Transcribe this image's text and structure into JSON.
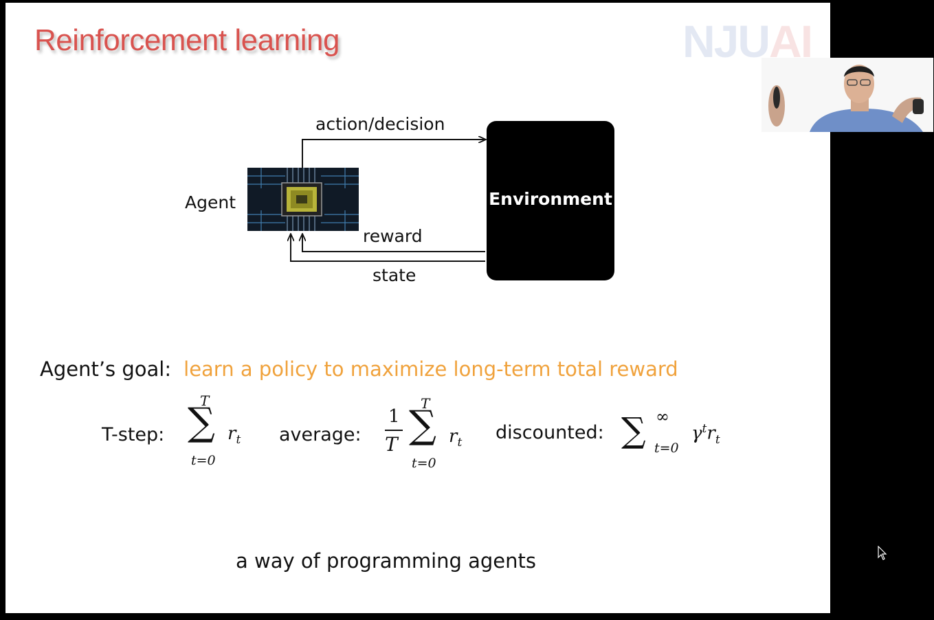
{
  "slide": {
    "title": "Reinforcement learning",
    "logo": {
      "part1": "NJU",
      "part2": "AI"
    },
    "diagram": {
      "agent_label": "Agent",
      "action_label": "action/decision",
      "environment_label": "Environment",
      "reward_label": "reward",
      "state_label": "state"
    },
    "goal": {
      "prefix": "Agent’s goal:",
      "text": "learn a policy to maximize long-term total reward"
    },
    "formulas": {
      "tstep_label": "T-step:",
      "average_label": "average:",
      "discounted_label": "discounted:"
    },
    "tagline": "a way of programming agents"
  },
  "colors": {
    "title": "#d9534f",
    "goal_highlight": "#f0a23c",
    "background": "#000000",
    "slide": "#ffffff"
  }
}
